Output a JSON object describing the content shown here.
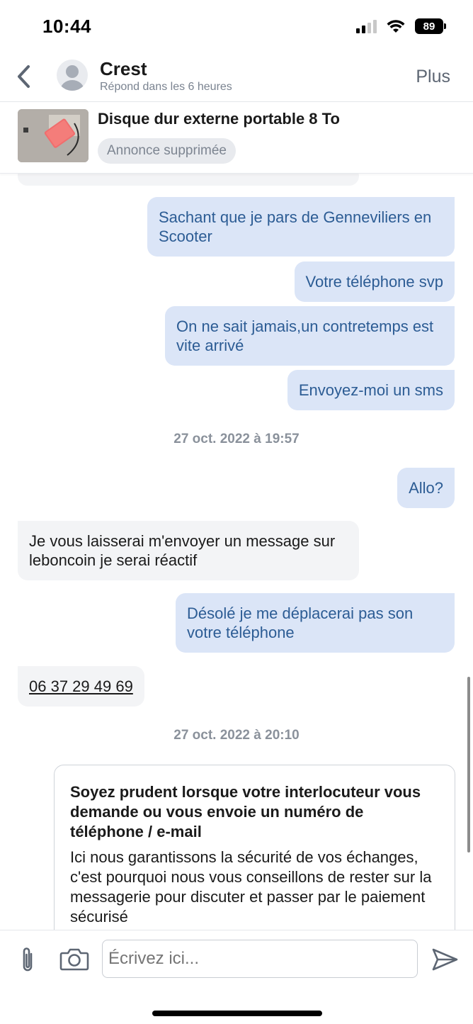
{
  "status_bar": {
    "time": "10:44",
    "battery": "89"
  },
  "header": {
    "contact_name": "Crest",
    "response_time": "Répond dans les 6 heures",
    "more_label": "Plus"
  },
  "ad": {
    "title": "Disque dur externe portable 8 To",
    "status": "Annonce supprimée"
  },
  "messages": [
    {
      "direction": "out",
      "text": "Sachant que je pars de Genneviliers en Scooter"
    },
    {
      "direction": "out",
      "text": "Votre téléphone svp"
    },
    {
      "direction": "out",
      "text": "On ne sait jamais,un contretemps est vite arrivé"
    },
    {
      "direction": "out",
      "text": "Envoyez-moi un sms"
    },
    {
      "direction": "out",
      "text": "Allo?"
    },
    {
      "direction": "in",
      "text": "Je vous laisserai m'envoyer un message sur leboncoin je serai réactif"
    },
    {
      "direction": "out",
      "text": "Désolé je me déplacerai pas son votre téléphone"
    },
    {
      "direction": "in",
      "text": "06 37 29 49 69"
    }
  ],
  "dates": [
    "27 oct. 2022 à 19:57",
    "27 oct. 2022 à 20:10"
  ],
  "warning": {
    "title": "Soyez prudent lorsque votre interlocuteur vous demande ou vous envoie un numéro de téléphone / e-mail",
    "body": "Ici nous garantissons la sécurité de vos échanges, c'est pourquoi nous vous conseillons de rester sur la messagerie pour discuter et passer par le paiement sécurisé"
  },
  "composer": {
    "placeholder": "Écrivez ici..."
  },
  "colors": {
    "outgoing_bubble": "#dbe5f7",
    "outgoing_text": "#2c5c94",
    "incoming_bubble": "#f3f4f6"
  },
  "icons": [
    "back-chevron-icon",
    "avatar-icon",
    "paperclip-icon",
    "camera-icon",
    "send-icon",
    "wifi-icon",
    "signal-icon",
    "battery-icon"
  ]
}
